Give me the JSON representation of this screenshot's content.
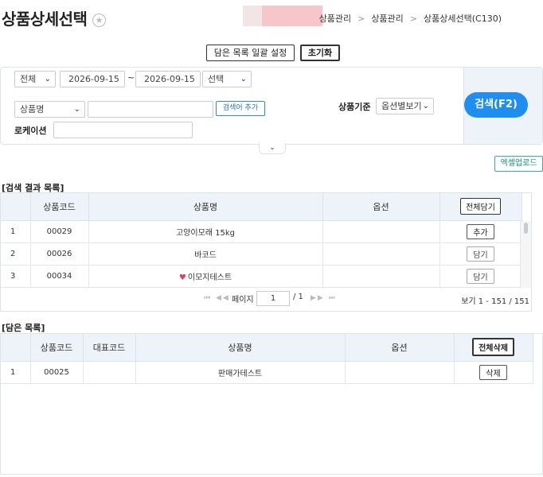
{
  "page": {
    "title": "상품상세선택",
    "star_icon": "star-icon"
  },
  "breadcrumb": {
    "items": [
      "상품관리",
      "상품관리",
      "상품상세선택(C130)"
    ],
    "separator": ">"
  },
  "top_buttons": {
    "bulk_set": "담은 목록 일괄 설정",
    "reset": "초기화"
  },
  "search": {
    "scope_select": "전체",
    "date_from": "2026-09-15",
    "date_to": "2026-09-15",
    "range_separator": "~",
    "type_select": "선택",
    "field_select": "상품명",
    "keyword_value": "",
    "add_term_button": "검색어 추가",
    "product_basis_label": "상품기준",
    "product_basis_select": "옵션별보기",
    "location_label": "로케이션",
    "location_value": "",
    "search_button": "검색(F2)",
    "toggle_icon": "chevron-down-icon"
  },
  "excel_upload_button": "엑셀업로드",
  "results": {
    "section_title": "[검색 결과 목록]",
    "columns": [
      "",
      "상품코드",
      "상품명",
      "옵션",
      "전체담기"
    ],
    "rows": [
      {
        "no": "1",
        "code": "00029",
        "name": "고양이모래 15kg",
        "option": "",
        "action": "추가",
        "heart": false
      },
      {
        "no": "2",
        "code": "00026",
        "name": "바코드",
        "option": "",
        "action": "담기",
        "heart": false
      },
      {
        "no": "3",
        "code": "00034",
        "name": "이모지테스트",
        "option": "",
        "action": "담기",
        "heart": true
      }
    ],
    "pager": {
      "page_label": "페이지",
      "current_page": "1",
      "total_pages": "/ 1",
      "range_text": "보기 1 - 151 / 151"
    }
  },
  "selected": {
    "section_title": "[담은 목록]",
    "columns": [
      "",
      "상품코드",
      "대표코드",
      "상품명",
      "옵션",
      "전체삭제"
    ],
    "rows": [
      {
        "no": "1",
        "code": "00025",
        "rep_code": "",
        "name": "판매가테스트",
        "option": "",
        "action": "삭제"
      }
    ]
  },
  "colors": {
    "accent": "#1f8ef1",
    "header_bg": "#eef3f9",
    "excel_border": "#2bb1a7",
    "breadcrumb_deco": "#f7c6cb"
  }
}
